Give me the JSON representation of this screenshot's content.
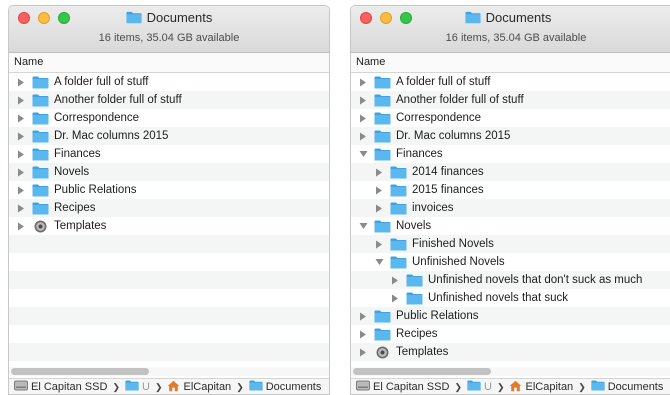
{
  "windows": [
    {
      "title": "Documents",
      "status": "16 items, 35.04 GB available",
      "column_name": "Name",
      "rows": [
        {
          "label": "A folder full of stuff",
          "depth": 0,
          "expanded": false,
          "icon": "folder-icon"
        },
        {
          "label": "Another folder full of stuff",
          "depth": 0,
          "expanded": false,
          "icon": "folder-icon"
        },
        {
          "label": "Correspondence",
          "depth": 0,
          "expanded": false,
          "icon": "folder-icon"
        },
        {
          "label": "Dr. Mac columns 2015",
          "depth": 0,
          "expanded": false,
          "icon": "folder-icon"
        },
        {
          "label": "Finances",
          "depth": 0,
          "expanded": false,
          "icon": "folder-icon"
        },
        {
          "label": "Novels",
          "depth": 0,
          "expanded": false,
          "icon": "folder-icon"
        },
        {
          "label": "Public Relations",
          "depth": 0,
          "expanded": false,
          "icon": "folder-icon"
        },
        {
          "label": "Recipes",
          "depth": 0,
          "expanded": false,
          "icon": "folder-icon"
        },
        {
          "label": "Templates",
          "depth": 0,
          "expanded": false,
          "icon": "templates-icon"
        }
      ],
      "empty_rows": 7,
      "path": [
        {
          "label": "El Capitan SSD",
          "icon": "disk-icon"
        },
        {
          "label": "U",
          "icon": "folder-icon"
        },
        {
          "label": "ElCapitan",
          "icon": "home-icon"
        },
        {
          "label": "Documents",
          "icon": "folder-icon"
        }
      ]
    },
    {
      "title": "Documents",
      "status": "16 items, 35.04 GB available",
      "column_name": "Name",
      "rows": [
        {
          "label": "A folder full of stuff",
          "depth": 0,
          "expanded": false,
          "icon": "folder-icon"
        },
        {
          "label": "Another folder full of stuff",
          "depth": 0,
          "expanded": false,
          "icon": "folder-icon"
        },
        {
          "label": "Correspondence",
          "depth": 0,
          "expanded": false,
          "icon": "folder-icon"
        },
        {
          "label": "Dr. Mac columns 2015",
          "depth": 0,
          "expanded": false,
          "icon": "folder-icon"
        },
        {
          "label": "Finances",
          "depth": 0,
          "expanded": true,
          "icon": "folder-icon"
        },
        {
          "label": "2014 finances",
          "depth": 1,
          "expanded": false,
          "icon": "folder-icon"
        },
        {
          "label": "2015 finances",
          "depth": 1,
          "expanded": false,
          "icon": "folder-icon"
        },
        {
          "label": "invoices",
          "depth": 1,
          "expanded": false,
          "icon": "folder-icon"
        },
        {
          "label": "Novels",
          "depth": 0,
          "expanded": true,
          "icon": "folder-icon"
        },
        {
          "label": "Finished Novels",
          "depth": 1,
          "expanded": false,
          "icon": "folder-icon"
        },
        {
          "label": "Unfinished Novels",
          "depth": 1,
          "expanded": true,
          "icon": "folder-icon"
        },
        {
          "label": "Unfinished novels that don't suck as much",
          "depth": 2,
          "expanded": false,
          "icon": "folder-icon"
        },
        {
          "label": "Unfinished novels that suck",
          "depth": 2,
          "expanded": false,
          "icon": "folder-icon"
        },
        {
          "label": "Public Relations",
          "depth": 0,
          "expanded": false,
          "icon": "folder-icon"
        },
        {
          "label": "Recipes",
          "depth": 0,
          "expanded": false,
          "icon": "folder-icon"
        },
        {
          "label": "Templates",
          "depth": 0,
          "expanded": false,
          "icon": "templates-icon"
        }
      ],
      "empty_rows": 0,
      "path": [
        {
          "label": "El Capitan SSD",
          "icon": "disk-icon"
        },
        {
          "label": "U",
          "icon": "folder-icon"
        },
        {
          "label": "ElCapitan",
          "icon": "home-icon"
        },
        {
          "label": "Documents",
          "icon": "folder-icon"
        }
      ]
    }
  ],
  "colors": {
    "folder": "#5ab8ee",
    "folder_tab": "#3fa3e0",
    "triangle": "#8a8a8a",
    "row_stripe": "#f4f5f5"
  }
}
